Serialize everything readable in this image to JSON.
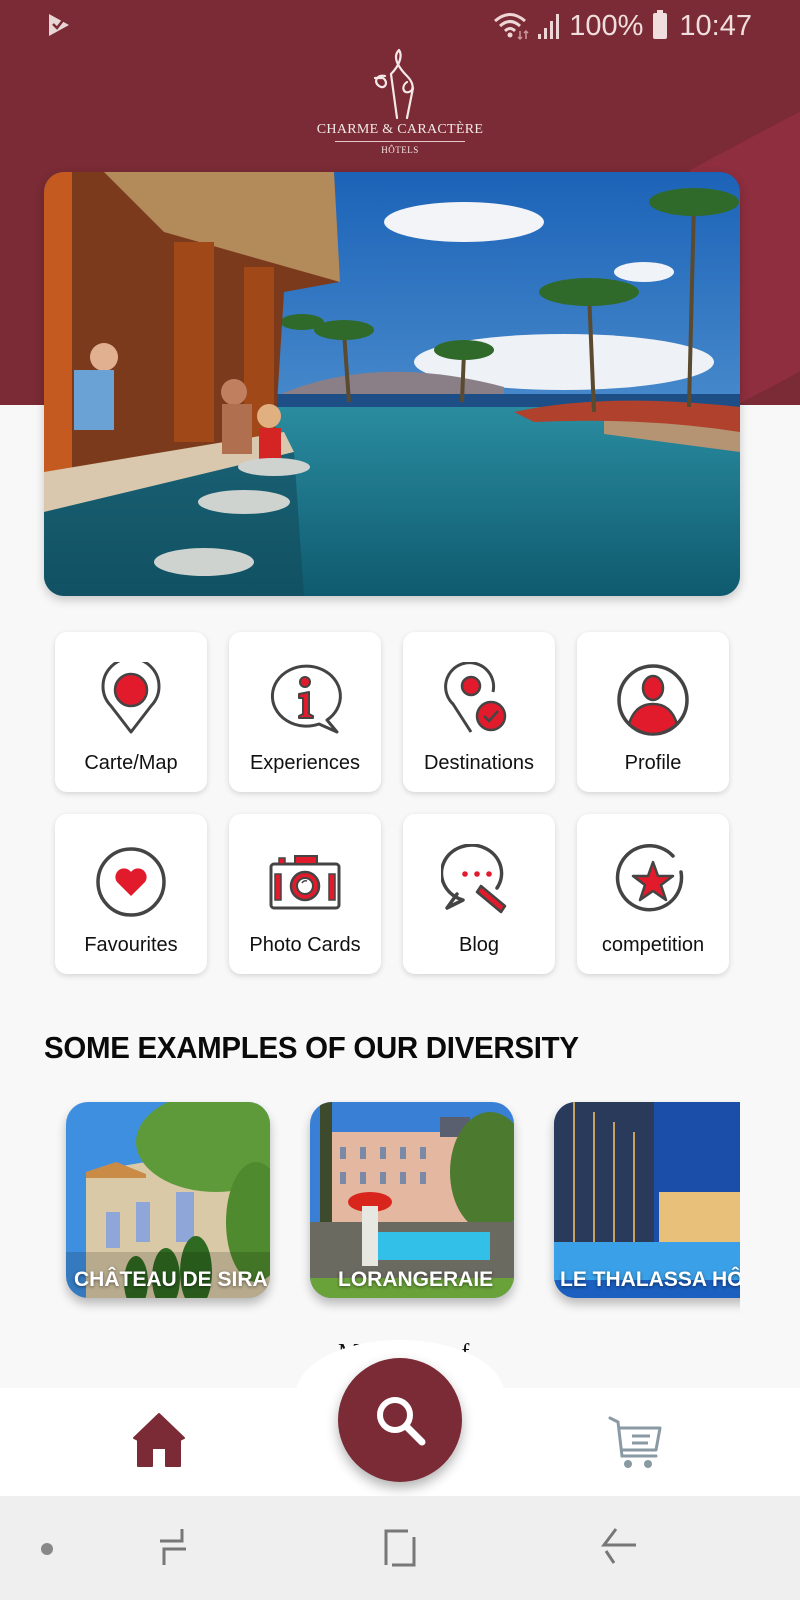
{
  "status_bar": {
    "battery": "100%",
    "time": "10:47",
    "icons": [
      "notification-app-icon",
      "wifi-icon",
      "signal-icon",
      "battery-icon"
    ]
  },
  "brand": {
    "name": "Charme & Caractère",
    "subtitle": "Hôtels",
    "colors": {
      "primary": "#7a2b35",
      "accent_red": "#e21b2c",
      "icon_stroke": "#444444"
    }
  },
  "hero": {
    "description": "Resort infinity pool with swim-up bar and palm trees"
  },
  "menu": [
    {
      "label": "Carte/Map",
      "icon": "map-pin-icon"
    },
    {
      "label": "Experiences",
      "icon": "info-bubble-icon"
    },
    {
      "label": "Destinations",
      "icon": "destination-pin-check-icon"
    },
    {
      "label": "Profile",
      "icon": "profile-icon"
    },
    {
      "label": "Favourites",
      "icon": "heart-icon"
    },
    {
      "label": "Photo Cards",
      "icon": "camera-icon"
    },
    {
      "label": "Blog",
      "icon": "blog-chat-pencil-icon"
    },
    {
      "label": "competition",
      "icon": "star-icon"
    }
  ],
  "diversity": {
    "title": "SOME EXAMPLES OF OUR DIVERSITY",
    "hotels": [
      {
        "name": "CHÂTEAU DE SIRA"
      },
      {
        "name": "LORANGERAIE"
      },
      {
        "name": "LE THALASSA HÔTEL"
      }
    ],
    "peek_text": "M  f"
  },
  "bottom_nav": {
    "home": "home-icon",
    "search": "search-icon",
    "cart": "cart-icon"
  },
  "system_nav": [
    "recents-button",
    "home-button",
    "back-button"
  ]
}
